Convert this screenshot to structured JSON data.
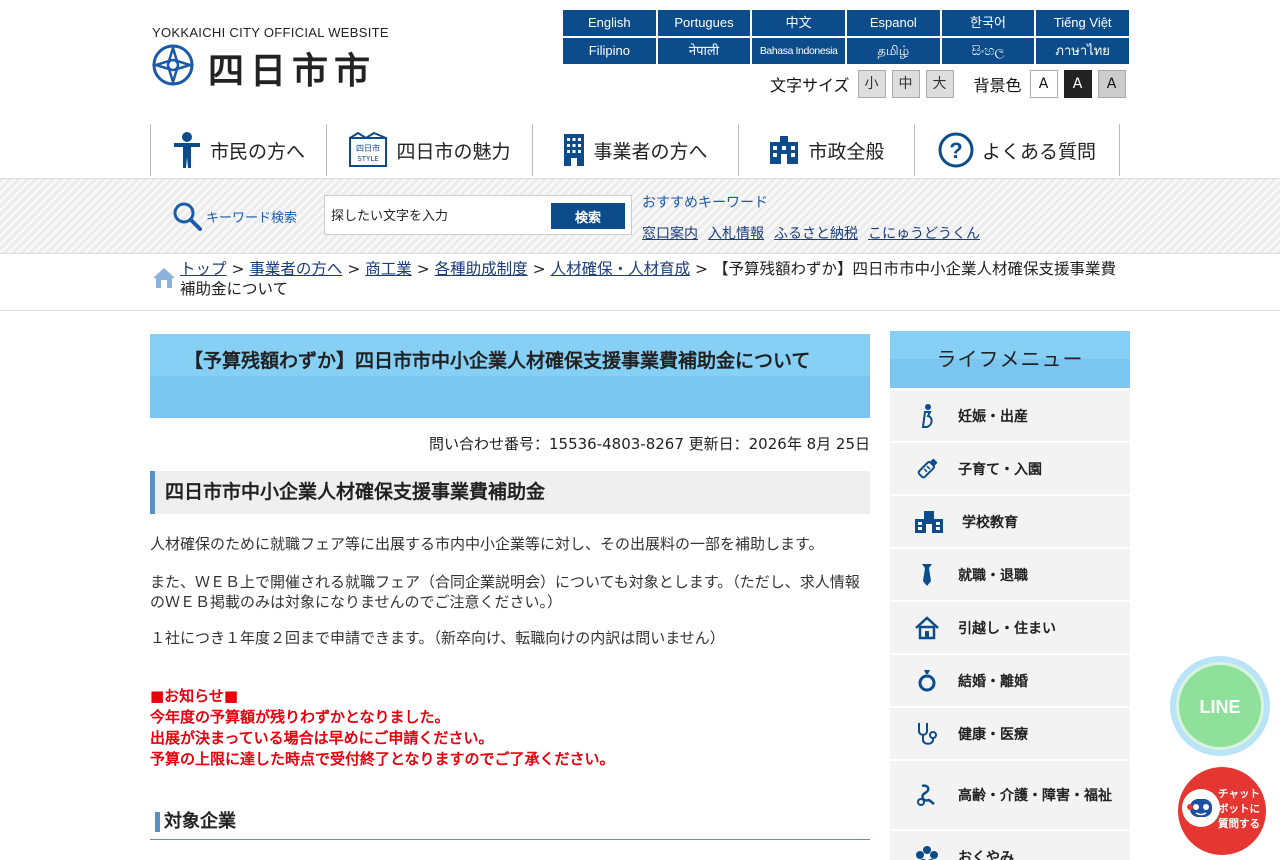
{
  "header": {
    "tagline": "YOKKAICHI CITY OFFICIAL WEBSITE",
    "logo_text": "四日市市",
    "languages": [
      "English",
      "Portugues",
      "中文",
      "Espanol",
      "한국어",
      "Tiếng Việt",
      "Filipino",
      "नेपाली",
      "Bahasa Indonesia",
      "தமிழ்",
      "සිංහල",
      "ภาษาไทย"
    ],
    "font_size_label": "文字サイズ",
    "font_sizes": [
      "小",
      "中",
      "大"
    ],
    "bg_color_label": "背景色",
    "bg_colors": [
      "A",
      "A",
      "A"
    ]
  },
  "nav": [
    {
      "label": "市民の方へ",
      "icon": "person-icon"
    },
    {
      "label": "四日市の魅力",
      "icon": "yokkaichi-style-icon"
    },
    {
      "label": "事業者の方へ",
      "icon": "office-building-icon"
    },
    {
      "label": "市政全般",
      "icon": "city-hall-icon"
    },
    {
      "label": "よくある質問",
      "icon": "question-icon"
    }
  ],
  "search": {
    "label": "キーワード検索",
    "placeholder": "探したい文字を入力",
    "button": "検索",
    "recommend_title": "おすすめキーワード",
    "recommend": [
      "窓口案内",
      "入札情報",
      "ふるさと納税",
      "こにゅうどうくん"
    ]
  },
  "breadcrumb": {
    "items": [
      "トップ",
      "事業者の方へ",
      "商工業",
      "各種助成制度",
      "人材確保・人材育成"
    ],
    "separator": ">",
    "current": "【予算残額わずか】四日市市中小企業人材確保支援事業費補助金について"
  },
  "article": {
    "title": "【予算残額わずか】四日市市中小企業人材確保支援事業費補助金について",
    "meta": "問い合わせ番号：15536-4803-8267 更新日：2026年 8月 25日",
    "heading": "四日市市中小企業人材確保支援事業費補助金",
    "paragraphs": [
      "人材確保のために就職フェア等に出展する市内中小企業等に対し、その出展料の一部を補助します。",
      "また、ＷＥＢ上で開催される就職フェア（合同企業説明会）についても対象とします。（ただし、求人情報のＷＥＢ掲載のみは対象になりませんのでご注意ください。）",
      "１社につき１年度２回まで申請できます。（新卒向け、転職向けの内訳は問いません）"
    ],
    "notice": [
      "■お知らせ■",
      "今年度の予算額が残りわずかとなりました。",
      "出展が決まっている場合は早めにご申請ください。",
      "予算の上限に達した時点で受付終了となりますのでご了承ください。"
    ],
    "subheading": "対象企業"
  },
  "life_menu": {
    "title": "ライフメニュー",
    "items": [
      {
        "label": "妊娠・出産",
        "icon": "pregnancy-icon"
      },
      {
        "label": "子育て・入園",
        "icon": "baby-bottle-icon"
      },
      {
        "label": "学校教育",
        "icon": "school-icon"
      },
      {
        "label": "就職・退職",
        "icon": "necktie-icon"
      },
      {
        "label": "引越し・住まい",
        "icon": "house-icon"
      },
      {
        "label": "結婚・離婚",
        "icon": "ring-icon"
      },
      {
        "label": "健康・医療",
        "icon": "stethoscope-icon"
      },
      {
        "label": "高齢・介護・障害・福祉",
        "icon": "elderly-icon"
      },
      {
        "label": "おくやみ",
        "icon": "flower-icon"
      }
    ]
  },
  "floating": {
    "line_label": "LINE",
    "chat_label": "チャットボットに質問する"
  },
  "colors": {
    "brand_blue": "#0c4c8a",
    "title_band": "#7ac6f1",
    "notice_red": "#e8000d",
    "accent_blue": "#5a8fc5"
  }
}
